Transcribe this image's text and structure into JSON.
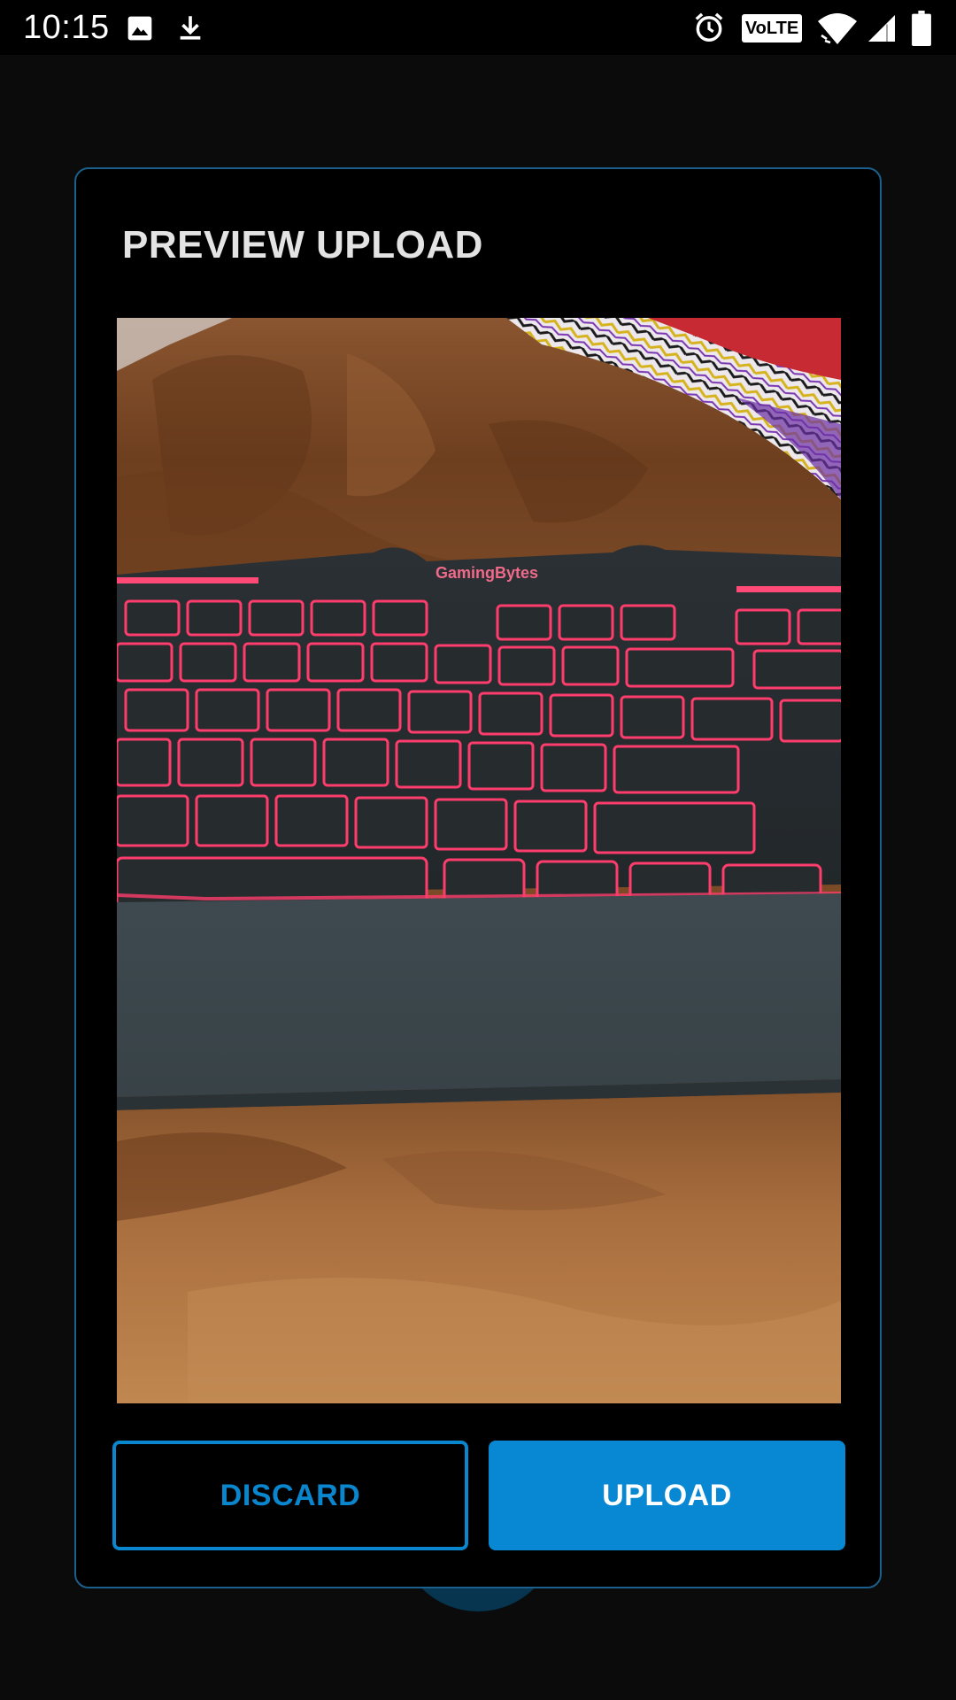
{
  "status_bar": {
    "time": "10:15",
    "icons": [
      "image-icon",
      "download-icon",
      "alarm-icon",
      "volte-icon",
      "wifi-icon",
      "signal-icon",
      "battery-icon"
    ],
    "volte_label": "VoLTE"
  },
  "dialog": {
    "title": "PREVIEW UPLOAD",
    "image_alt": "Photo of a black gaming keyboard with red backlight on a brown blanket",
    "keyboard_brand": "GamingBytes",
    "discard_label": "DISCARD",
    "upload_label": "UPLOAD"
  },
  "colors": {
    "accent": "#0888d2",
    "dialog_border": "#1b5f8c",
    "background": "#0b0b0c",
    "dialog_bg": "#000000",
    "title_text": "#e3e3e3"
  }
}
